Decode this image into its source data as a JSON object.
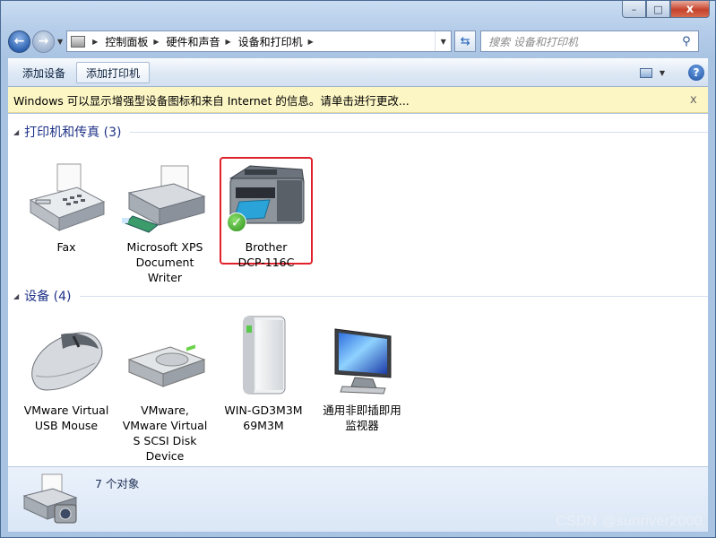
{
  "window": {
    "minimize": "–",
    "maximize": "□",
    "close": "x"
  },
  "nav": {
    "back": "←",
    "forward": "→",
    "dropdown": "▼",
    "breadcrumb": [
      "控制面板",
      "硬件和声音",
      "设备和打印机"
    ],
    "refresh": "⇆",
    "search_placeholder": "搜索 设备和打印机"
  },
  "toolbar": {
    "add_device": "添加设备",
    "add_printer": "添加打印机",
    "help": "?"
  },
  "infobar": {
    "message": "Windows 可以显示增强型设备图标和来自 Internet 的信息。请单击进行更改...",
    "close": "x"
  },
  "groups": [
    {
      "title": "打印机和传真 (3)",
      "items": [
        {
          "label": "Fax",
          "icon": "fax-icon"
        },
        {
          "label": "Microsoft XPS\nDocument\nWriter",
          "icon": "printer-icon"
        },
        {
          "label": "Brother\nDCP-116C",
          "icon": "multifunction-printer-icon",
          "selected": true,
          "default": true
        }
      ]
    },
    {
      "title": "设备 (4)",
      "items": [
        {
          "label": "VMware Virtual\nUSB Mouse",
          "icon": "mouse-icon"
        },
        {
          "label": "VMware,\nVMware Virtual\nS SCSI Disk\nDevice",
          "icon": "hard-disk-icon"
        },
        {
          "label": "WIN-GD3M3M\n69M3M",
          "icon": "computer-tower-icon"
        },
        {
          "label": "通用非即插即用\n监视器",
          "icon": "monitor-icon"
        }
      ]
    }
  ],
  "details": {
    "count": "7 个对象"
  },
  "watermark": "CSDN @sunriver2000",
  "colors": {
    "accent": "#1e3287",
    "selection": "#e0202a",
    "infobar": "#fcf6c5"
  }
}
